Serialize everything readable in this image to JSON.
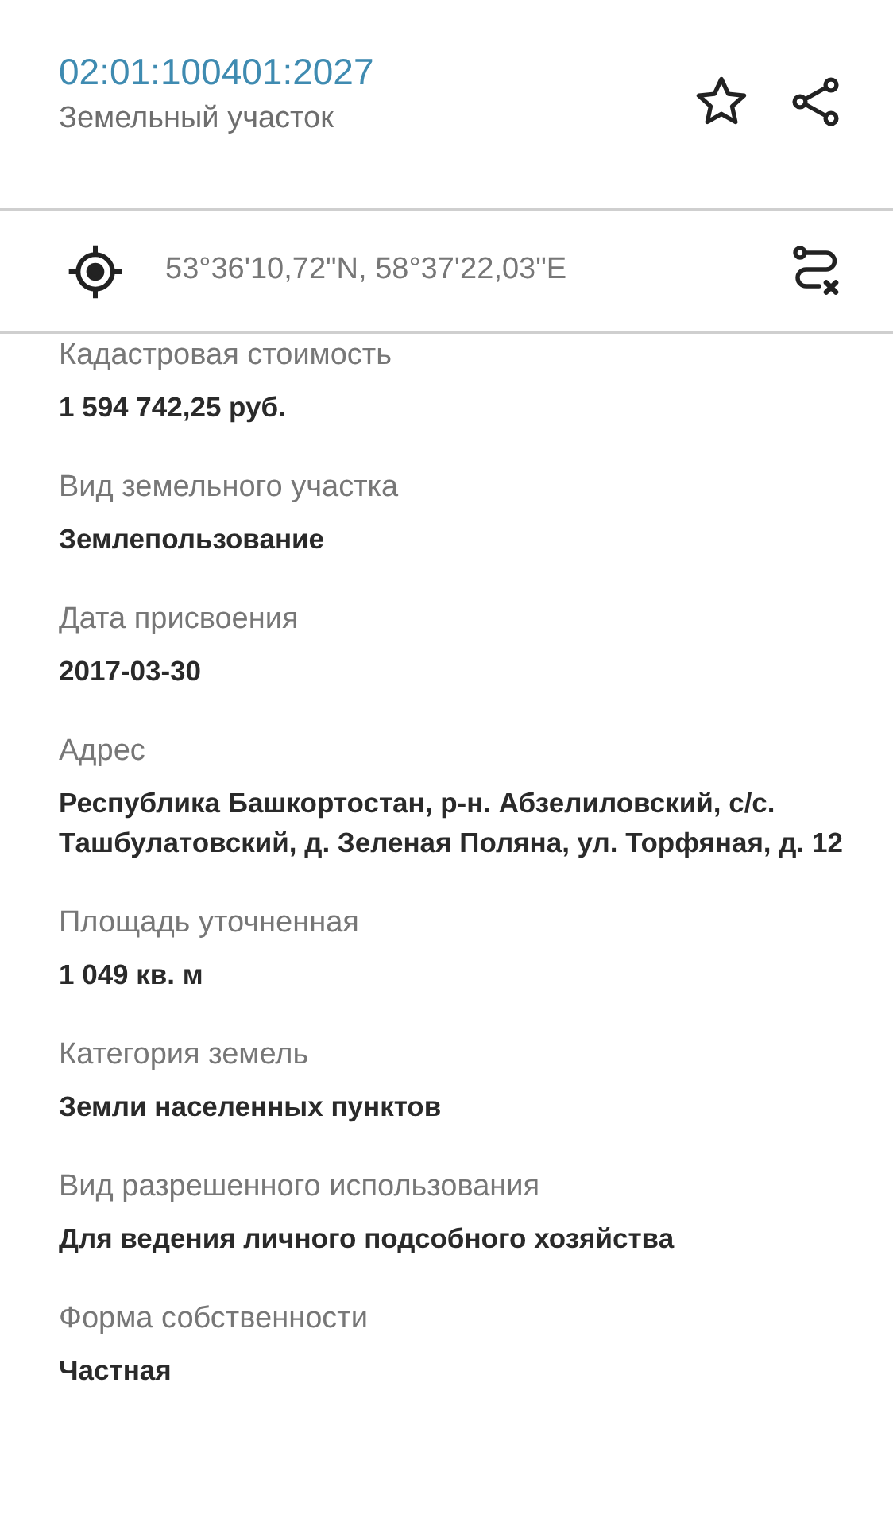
{
  "header": {
    "title": "02:01:100401:2027",
    "subtitle": "Земельный участок"
  },
  "coordinates": {
    "text": "53°36'10,72\"N, 58°37'22,03\"E"
  },
  "fields": [
    {
      "label": "Кадастровая стоимость",
      "value": "1 594 742,25 руб."
    },
    {
      "label": "Вид земельного участка",
      "value": "Землепользование"
    },
    {
      "label": "Дата присвоения",
      "value": "2017-03-30"
    },
    {
      "label": "Адрес",
      "value": "Республика Башкортостан, р-н. Абзелиловский, с/с. Ташбулатовский, д. Зеленая Поляна, ул. Торфяная, д. 12"
    },
    {
      "label": "Площадь уточненная",
      "value": "1 049 кв. м"
    },
    {
      "label": "Категория земель",
      "value": "Земли населенных пунктов"
    },
    {
      "label": "Вид разрешенного использования",
      "value": "Для ведения личного подсобного хозяйства"
    },
    {
      "label": "Форма собственности",
      "value": "Частная"
    }
  ]
}
